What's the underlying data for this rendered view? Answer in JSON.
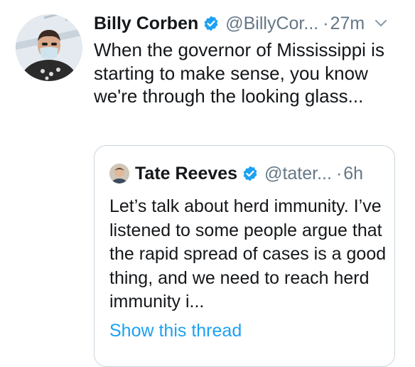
{
  "tweet": {
    "avatar_icon": "user-avatar-photo",
    "author_name": "Billy Corben",
    "verified_icon": "verified-badge-icon",
    "handle": "@BillyCor...",
    "separator": "·",
    "time": "27m",
    "menu_icon": "chevron-down-icon",
    "text": "When the governor of Mississippi is starting to make sense, you know we're through the looking glass..."
  },
  "quoted_tweet": {
    "avatar_icon": "quoted-user-avatar-photo",
    "author_name": "Tate Reeves",
    "verified_icon": "verified-badge-icon",
    "handle": "@tater...",
    "separator": "·",
    "time": "6h",
    "text": "Let’s talk about herd immunity. I’ve listened to some people argue that the rapid spread of cases is a good thing, and we need to reach herd immunity i...",
    "show_thread_label": "Show this thread"
  },
  "colors": {
    "text": "#14171a",
    "secondary": "#657786",
    "link": "#1da1f2",
    "verified": "#1da1f2",
    "border": "#ccd6dd"
  }
}
